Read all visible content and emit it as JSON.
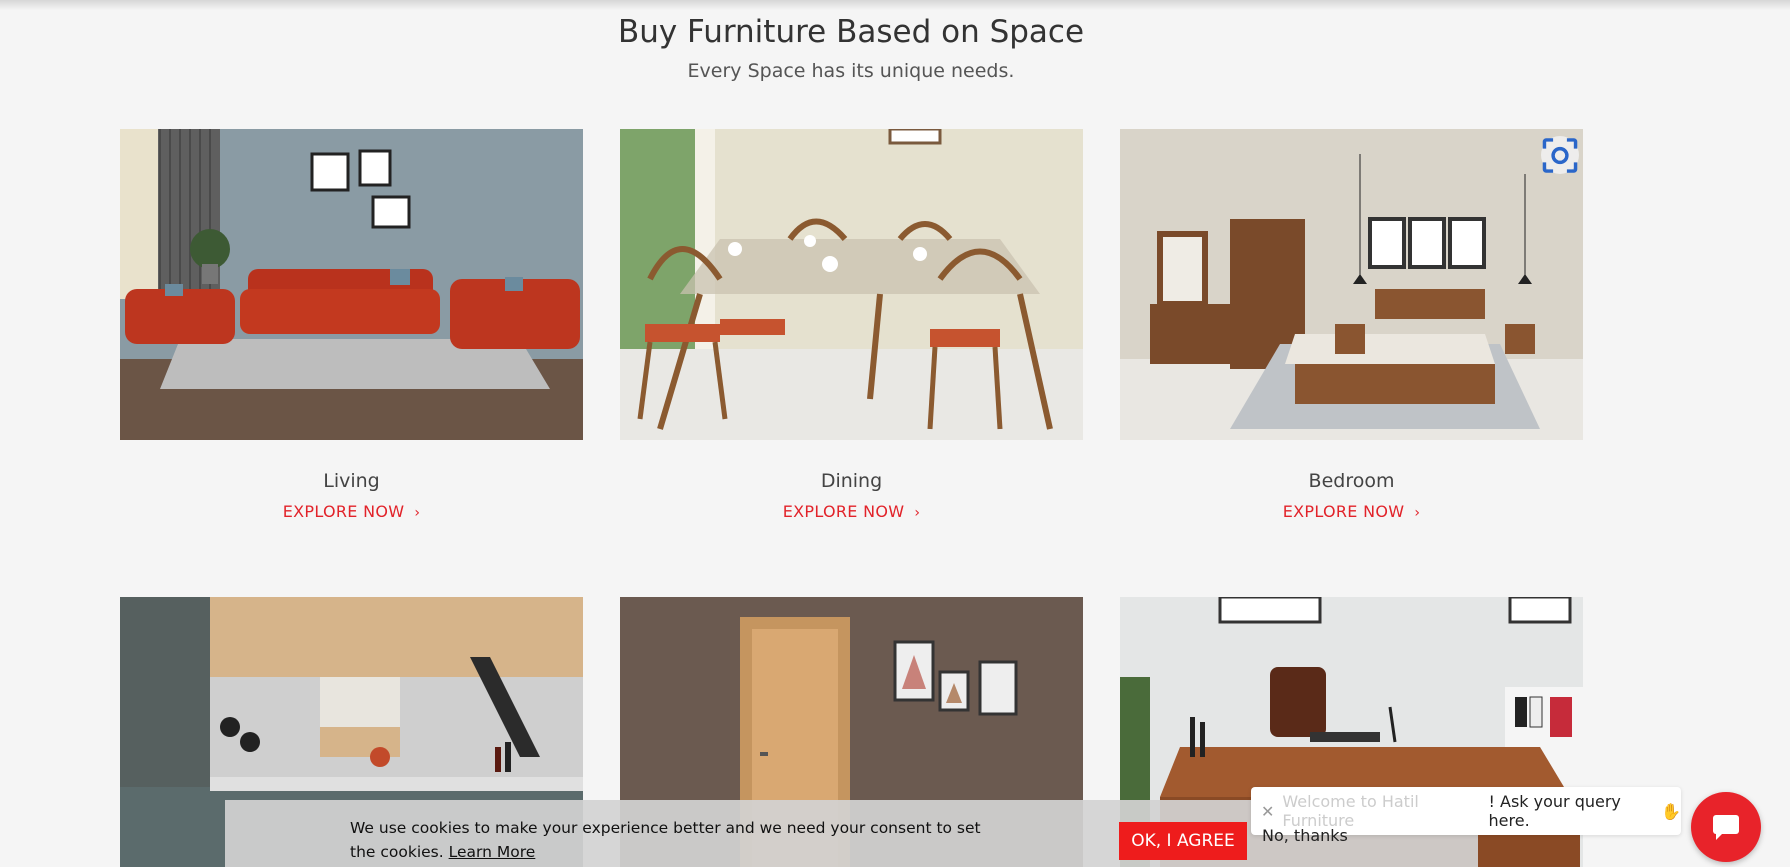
{
  "section": {
    "title": "Buy Furniture Based on Space",
    "subtitle": "Every Space has its unique needs."
  },
  "cards": [
    {
      "name": "Living",
      "link": "EXPLORE NOW",
      "image": "living-room-photo"
    },
    {
      "name": "Dining",
      "link": "EXPLORE NOW",
      "image": "dining-room-photo"
    },
    {
      "name": "Bedroom",
      "link": "EXPLORE NOW",
      "image": "bedroom-photo"
    },
    {
      "image": "kitchen-photo"
    },
    {
      "image": "door-photo"
    },
    {
      "image": "office-photo"
    }
  ],
  "cookie": {
    "text": "We use cookies to make your experience better and we need your consent to set the cookies.",
    "learn_more": "Learn More",
    "agree_label": "OK, I AGREE"
  },
  "chat": {
    "welcome_faded": "Welcome to Hatil Furniture",
    "welcome_rest": "! Ask your query here.",
    "wave": "✋",
    "dismiss": "No, thanks"
  },
  "icons": {
    "chevron": "chevron-right-icon",
    "lens": "visual-search-icon",
    "chat": "chat-bubble-icon",
    "close": "close-icon"
  },
  "colors": {
    "accent": "#e2232a",
    "agree": "#ee1c1c",
    "background": "#f5f5f5"
  }
}
